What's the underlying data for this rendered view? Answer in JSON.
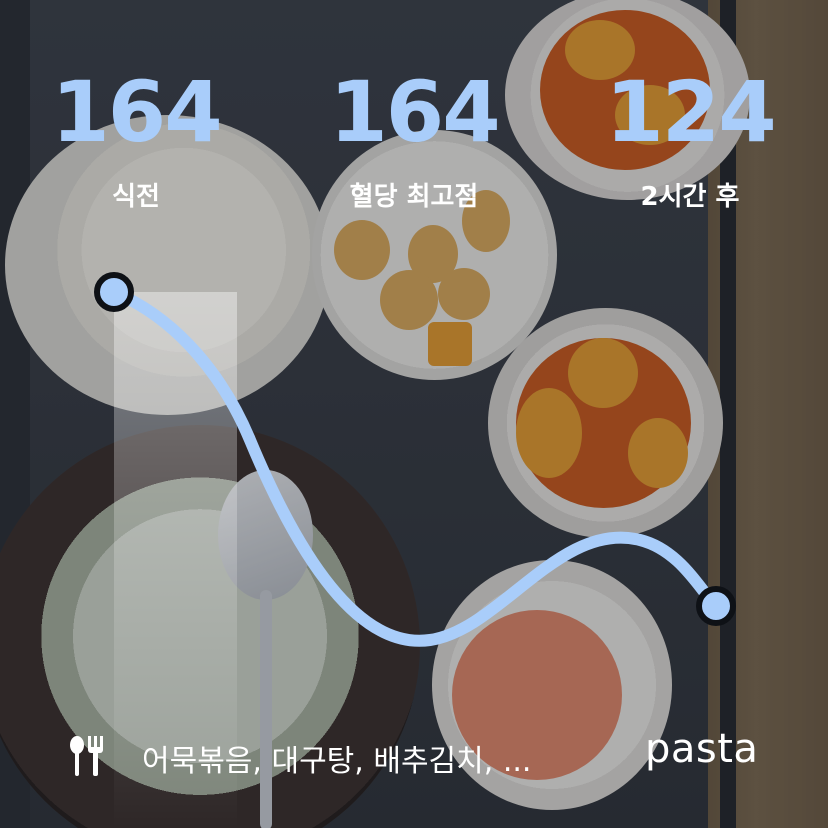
{
  "colors": {
    "accent": "#a9cdfa",
    "text": "#ffffff",
    "dot_outline": "#0e1116"
  },
  "stats": [
    {
      "value": "164",
      "label": "식전"
    },
    {
      "value": "164",
      "label": "혈당 최고점"
    },
    {
      "value": "124",
      "label": "2시간 후"
    }
  ],
  "chart_data": {
    "type": "line",
    "series": [
      {
        "values": [
          164,
          164,
          124
        ]
      }
    ],
    "labels": [
      "식전",
      "혈당 최고점",
      "2시간 후"
    ]
  },
  "footer": {
    "icon": "fork-knife-icon",
    "foods": "어묵볶음, 대구탕, 배추김치, ...",
    "brand": "pasta"
  }
}
